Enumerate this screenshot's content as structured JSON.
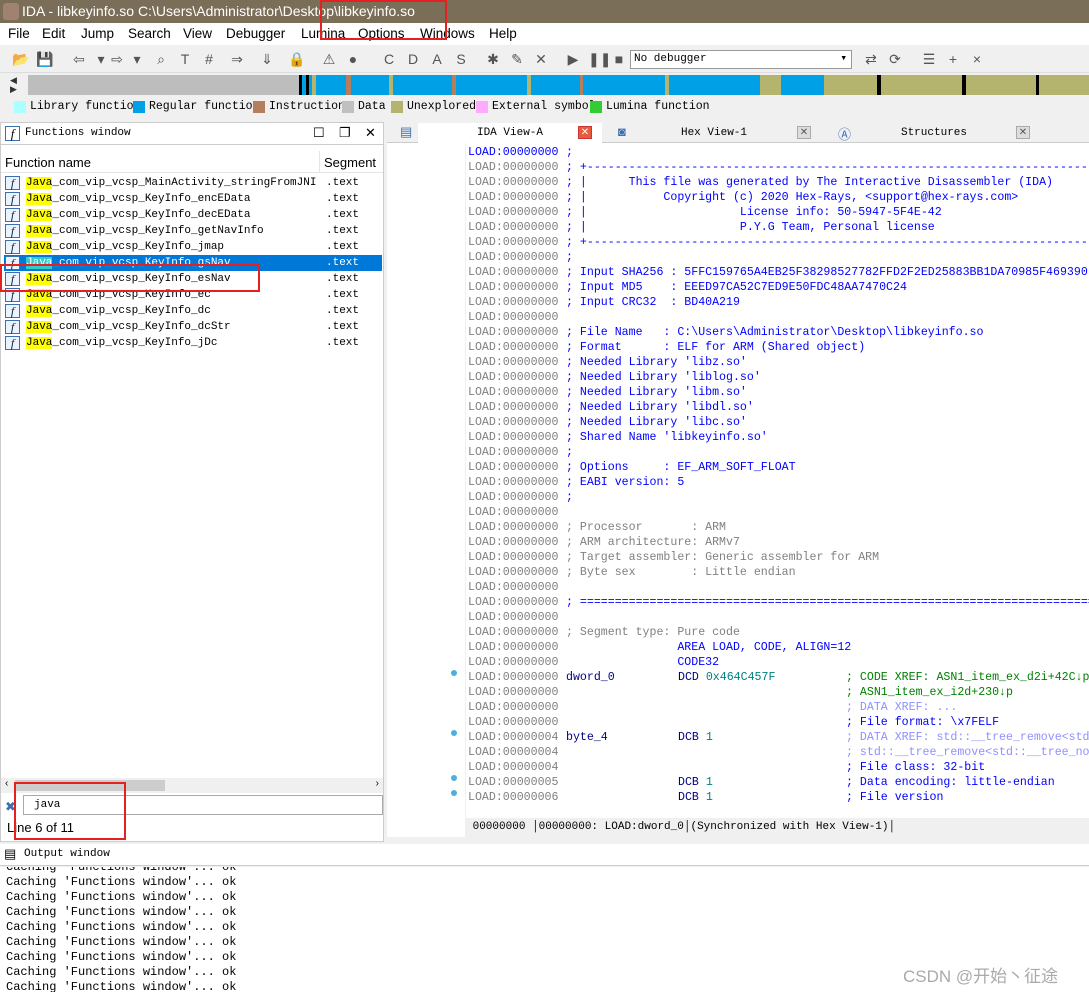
{
  "window": {
    "title": "IDA - libkeyinfo.so C:\\Users\\Administrator\\Desktop\\libkeyinfo.so"
  },
  "menu": [
    "File",
    "Edit",
    "Jump",
    "Search",
    "View",
    "Debugger",
    "Lumina",
    "Options",
    "Windows",
    "Help"
  ],
  "toolbar": {
    "debugger_select": "No debugger"
  },
  "legend": [
    {
      "label": "Library function",
      "color": "#aaffff"
    },
    {
      "label": "Regular function",
      "color": "#00a0e6"
    },
    {
      "label": "Instruction",
      "color": "#b57f5f"
    },
    {
      "label": "Data",
      "color": "#c0c0c0"
    },
    {
      "label": "Unexplored",
      "color": "#b4b46e"
    },
    {
      "label": "External symbol",
      "color": "#ffaaff"
    },
    {
      "label": "Lumina function",
      "color": "#33cc33"
    }
  ],
  "functions_window": {
    "title": "Functions window",
    "col_name": "Function name",
    "col_segment": "Segment",
    "rows": [
      {
        "prefix": "Java",
        "name": "_com_vip_vcsp_MainActivity_stringFromJNI",
        "segment": ".text"
      },
      {
        "prefix": "Java",
        "name": "_com_vip_vcsp_KeyInfo_encEData",
        "segment": ".text"
      },
      {
        "prefix": "Java",
        "name": "_com_vip_vcsp_KeyInfo_decEData",
        "segment": ".text"
      },
      {
        "prefix": "Java",
        "name": "_com_vip_vcsp_KeyInfo_getNavInfo",
        "segment": ".text"
      },
      {
        "prefix": "Java",
        "name": "_com_vip_vcsp_KeyInfo_jmap",
        "segment": ".text"
      },
      {
        "prefix": "Java",
        "name": "_com_vip_vcsp_KeyInfo_gsNav",
        "segment": ".text",
        "selected": true
      },
      {
        "prefix": "Java",
        "name": "_com_vip_vcsp_KeyInfo_esNav",
        "segment": ".text"
      },
      {
        "prefix": "Java",
        "name": "_com_vip_vcsp_KeyInfo_ec",
        "segment": ".text"
      },
      {
        "prefix": "Java",
        "name": "_com_vip_vcsp_KeyInfo_dc",
        "segment": ".text"
      },
      {
        "prefix": "Java",
        "name": "_com_vip_vcsp_KeyInfo_dcStr",
        "segment": ".text"
      },
      {
        "prefix": "Java",
        "name": "_com_vip_vcsp_KeyInfo_jDc",
        "segment": ".text"
      }
    ],
    "filter_value": "java",
    "status": "Line 6 of 11"
  },
  "tabs": [
    {
      "label": "IDA View-A"
    },
    {
      "label": "Hex View-1"
    },
    {
      "label": "Structures"
    }
  ],
  "ida_view": {
    "lines": [
      {
        "a": "LOAD:00000000",
        "t": ";",
        "c": "c1"
      },
      {
        "a": "LOAD:00000000",
        "t": "; +-------------------------------------------------------------------------",
        "c": "c1"
      },
      {
        "a": "LOAD:00000000",
        "t": "; |      This file was generated by The Interactive Disassembler (IDA)",
        "c": "c1"
      },
      {
        "a": "LOAD:00000000",
        "t": "; |           Copyright (c) 2020 Hex-Rays, <support@hex-rays.com>",
        "c": "c1"
      },
      {
        "a": "LOAD:00000000",
        "t": "; |                      License info: 50-5947-5F4E-42",
        "c": "c1"
      },
      {
        "a": "LOAD:00000000",
        "t": "; |                      P.Y.G Team, Personal license",
        "c": "c1"
      },
      {
        "a": "LOAD:00000000",
        "t": "; +-------------------------------------------------------------------------",
        "c": "c1"
      },
      {
        "a": "LOAD:00000000",
        "t": ";",
        "c": "c1"
      },
      {
        "a": "LOAD:00000000",
        "t": "; Input SHA256 : 5FFC159765A4EB25F38298527782FFD2F2ED25883BB1DA70985F469390",
        "c": "c1"
      },
      {
        "a": "LOAD:00000000",
        "t": "; Input MD5    : EEED97CA52C7ED9E50FDC48AA7470C24",
        "c": "c1"
      },
      {
        "a": "LOAD:00000000",
        "t": "; Input CRC32  : BD40A219",
        "c": "c1"
      },
      {
        "a": "LOAD:00000000",
        "t": "",
        "c": "c1"
      },
      {
        "a": "LOAD:00000000",
        "t": "; File Name   : C:\\Users\\Administrator\\Desktop\\libkeyinfo.so",
        "c": "c1"
      },
      {
        "a": "LOAD:00000000",
        "t": "; Format      : ELF for ARM (Shared object)",
        "c": "c1"
      },
      {
        "a": "LOAD:00000000",
        "t": "; Needed Library 'libz.so'",
        "c": "c1"
      },
      {
        "a": "LOAD:00000000",
        "t": "; Needed Library 'liblog.so'",
        "c": "c1"
      },
      {
        "a": "LOAD:00000000",
        "t": "; Needed Library 'libm.so'",
        "c": "c1"
      },
      {
        "a": "LOAD:00000000",
        "t": "; Needed Library 'libdl.so'",
        "c": "c1"
      },
      {
        "a": "LOAD:00000000",
        "t": "; Needed Library 'libc.so'",
        "c": "c1"
      },
      {
        "a": "LOAD:00000000",
        "t": "; Shared Name 'libkeyinfo.so'",
        "c": "c1"
      },
      {
        "a": "LOAD:00000000",
        "t": ";",
        "c": "c1"
      },
      {
        "a": "LOAD:00000000",
        "t": "; Options     : EF_ARM_SOFT_FLOAT",
        "c": "c1"
      },
      {
        "a": "LOAD:00000000",
        "t": "; EABI version: 5",
        "c": "c1"
      },
      {
        "a": "LOAD:00000000",
        "t": ";",
        "c": "c1"
      },
      {
        "a": "LOAD:00000000",
        "t": "",
        "c": "c1"
      },
      {
        "a": "LOAD:00000000",
        "t": "; Processor       : ARM",
        "c": "cg"
      },
      {
        "a": "LOAD:00000000",
        "t": "; ARM architecture: ARMv7",
        "c": "cg"
      },
      {
        "a": "LOAD:00000000",
        "t": "; Target assembler: Generic assembler for ARM",
        "c": "cg"
      },
      {
        "a": "LOAD:00000000",
        "t": "; Byte sex        : Little endian",
        "c": "cg"
      },
      {
        "a": "LOAD:00000000",
        "t": "",
        "c": "c1"
      },
      {
        "a": "LOAD:00000000",
        "t": "; ===========================================================================",
        "c": "c1"
      },
      {
        "a": "LOAD:00000000",
        "t": "",
        "c": "c1"
      },
      {
        "a": "LOAD:00000000",
        "t": "; Segment type: Pure code",
        "c": "cg"
      },
      {
        "a": "LOAD:00000000",
        "t": "                AREA LOAD, CODE, ALIGN=12",
        "c": "c1"
      },
      {
        "a": "LOAD:00000000",
        "t": "                CODE32",
        "c": "c1"
      },
      {
        "a": "LOAD:00000000",
        "lbl": "dword_0",
        "ins": "DCD",
        "op": "0x464C457F",
        "cm": "; CODE XREF: ASN1_item_ex_d2i+42C↓p",
        "cc": "cx"
      },
      {
        "a": "LOAD:00000000",
        "cm": "; ASN1_item_ex_i2d+230↓p",
        "cc": "cx"
      },
      {
        "a": "LOAD:00000000",
        "cm": "; DATA XREF: ...",
        "cc": "cd"
      },
      {
        "a": "LOAD:00000000",
        "cm": "; File format: \\x7FELF",
        "cc": "c1"
      },
      {
        "a": "LOAD:00000004",
        "lbl": "byte_4",
        "ins": "DCB",
        "op": "1",
        "cm": "; DATA XREF: std::__tree_remove<std::__tree_node",
        "cc": "cd"
      },
      {
        "a": "LOAD:00000004",
        "cm": "; std::__tree_remove<std::__tree_node",
        "cc": "cd"
      },
      {
        "a": "LOAD:00000004",
        "cm": "; File class: 32-bit",
        "cc": "c1"
      },
      {
        "a": "LOAD:00000005",
        "ins": "DCB",
        "op": "1",
        "cm": "; Data encoding: little-endian",
        "cc": "c1"
      },
      {
        "a": "LOAD:00000006",
        "ins": "DCB",
        "op": "1",
        "cm": "; File version",
        "cc": "c1"
      }
    ],
    "status_offset": "00000000",
    "status_loc": "00000000: LOAD:dword_0",
    "status_sync": "(Synchronized with Hex View-1)"
  },
  "output_window": {
    "title": "Output window",
    "lines": [
      "Caching 'Functions window'... ok",
      "Caching 'Functions window'... ok",
      "Caching 'Functions window'... ok",
      "Caching 'Functions window'... ok",
      "Caching 'Functions window'... ok",
      "Caching 'Functions window'... ok",
      "Caching 'Functions window'... ok",
      "Caching 'Functions window'... ok"
    ]
  },
  "watermark": "CSDN @开始丶征途"
}
